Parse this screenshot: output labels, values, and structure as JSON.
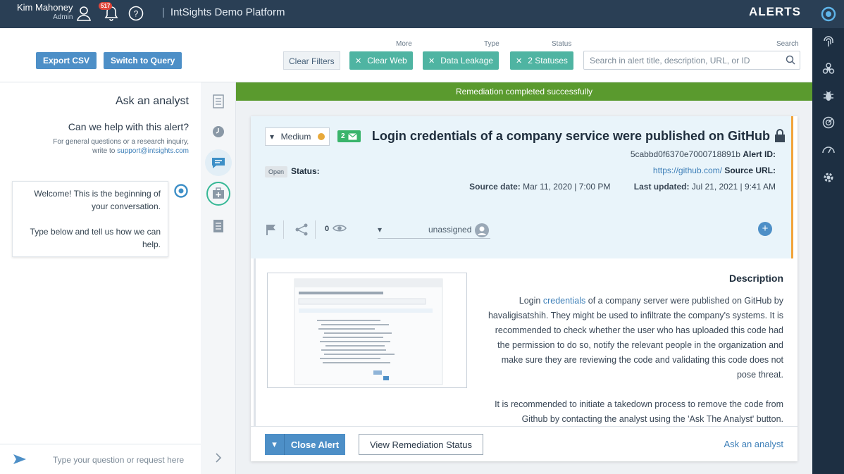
{
  "topbar": {
    "user_name": "Kim Mahoney",
    "user_role": "Admin",
    "notification_count": "517",
    "platform_title": "IntSights Demo Platform",
    "page_title": "ALERTS"
  },
  "filters": {
    "export_label": "Export CSV",
    "switch_label": "Switch to Query",
    "clear_label": "Clear Filters",
    "more_label": "More",
    "type_label": "Type",
    "status_label": "Status",
    "search_label": "Search",
    "chips": [
      {
        "label": "Clear Web"
      },
      {
        "label": "Data Leakage"
      },
      {
        "label": "2 Statuses"
      }
    ],
    "search_placeholder": "Search in alert title, description, URL, or ID"
  },
  "chat": {
    "title": "Ask an analyst",
    "help_question": "Can we help with this alert?",
    "help_text": "For general questions or a research inquiry, write to",
    "help_email": "support@intsights.com",
    "welcome_1": "Welcome! This is the beginning of your conversation.",
    "welcome_2": "Type below and tell us how we can help.",
    "input_placeholder": "Type your question or request here"
  },
  "banner": "Remediation completed successfully",
  "alert": {
    "title": "Login credentials of a company service were published on GitHub",
    "severity": "Medium",
    "mail_count": "2",
    "status_label": "Status:",
    "status_value": "Open",
    "id_label": "Alert ID:",
    "id_value": "5cabbd0f6370e7000718891b",
    "source_url_label": "Source URL:",
    "source_url": "https://github.com/",
    "last_updated_label": "Last updated:",
    "last_updated": "Jul 21, 2021 | 9:41 AM",
    "source_date_label": "Source date:",
    "source_date": "Mar 11, 2020 | 7:00 PM",
    "assignee": "unassigned",
    "views": "0",
    "description_title": "Description",
    "description_p1_pre": "Login",
    "description_p1_link": "credentials",
    "description_p1_post": "of a company server were published on GitHub by havaligisatshih. They might be used to infiltrate the company's systems. It is recommended to check whether the user who has uploaded this code had the permission to do so, notify the relevant people in the organization and make sure they are reviewing the code and validating this code does not pose threat.",
    "description_p2": "It is recommended to initiate a takedown process to remove the code from Github by contacting the analyst using the 'Ask The Analyst' button.",
    "close_label": "Close Alert",
    "remediation_label": "View Remediation Status",
    "ask_label": "Ask an analyst"
  },
  "colors": {
    "topbar": "#2a3f55",
    "rail": "#1d2f42",
    "accent_blue": "#4d8fc7",
    "chip_teal": "#4fb4a2",
    "success_green": "#5a9a2e",
    "severity_medium": "#e8a93a",
    "border_orange": "#f2a33a"
  }
}
